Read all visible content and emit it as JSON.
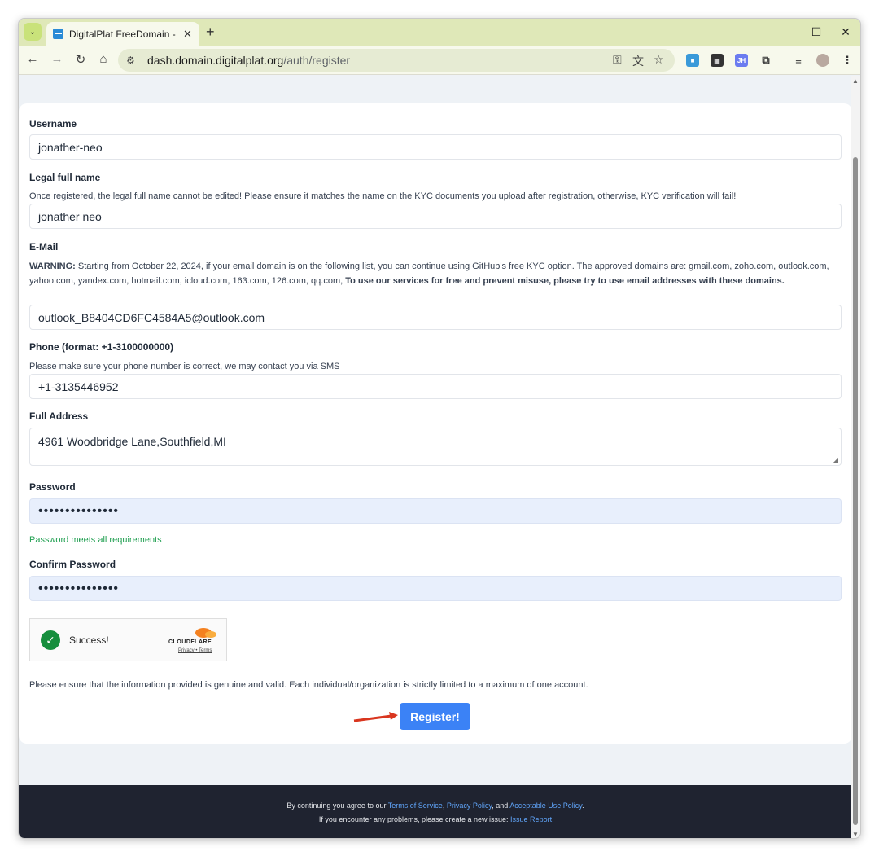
{
  "browser": {
    "tab_title": "DigitalPlat FreeDomain - Reg",
    "url_host": "dash.domain.digitalplat.org",
    "url_path": "/auth/register",
    "new_tab": "+",
    "tab_close": "✕",
    "window_controls": {
      "minimize": "–",
      "maximize": "☐",
      "close": "✕"
    },
    "nav": {
      "back": "←",
      "forward": "→",
      "reload": "↻",
      "home": "⌂"
    },
    "extensions": [
      "key-icon",
      "translate-icon",
      "star-icon",
      "apps-icon",
      "grid-icon",
      "jh-extension-icon",
      "puzzle-icon",
      "reading-list-icon",
      "profile-avatar",
      "menu-icon"
    ],
    "ext_jh_label": "JH"
  },
  "form": {
    "username": {
      "label": "Username",
      "value": "jonather-neo"
    },
    "legal_name": {
      "label": "Legal full name",
      "help": "Once registered, the legal full name cannot be edited! Please ensure it matches the name on the KYC documents you upload after registration, otherwise, KYC verification will fail!",
      "value": "jonather neo"
    },
    "email": {
      "label": "E-Mail",
      "warning_prefix": "WARNING:",
      "warning_body": " Starting from October 22, 2024, if your email domain is on the following list, you can continue using GitHub's free KYC option. The approved domains are: gmail.com, zoho.com, outlook.com, yahoo.com, yandex.com, hotmail.com, icloud.com, 163.com, 126.com, qq.com, ",
      "warning_bold": "To use our services for free and prevent misuse, please try to use email addresses with these domains.",
      "value": "outlook_B8404CD6FC4584A5@outlook.com"
    },
    "phone": {
      "label": "Phone (format: +1-3100000000)",
      "help": "Please make sure your phone number is correct, we may contact you via SMS",
      "value": "+1-3135446952"
    },
    "address": {
      "label": "Full Address",
      "value": "4961 Woodbridge Lane,Southfield,MI"
    },
    "password": {
      "label": "Password",
      "value": "•••••••••••••••",
      "status": "Password meets all requirements"
    },
    "confirm_password": {
      "label": "Confirm Password",
      "value": "•••••••••••••••"
    },
    "captcha": {
      "status": "Success!",
      "brand": "CLOUDFLARE",
      "links": "Privacy • Terms"
    },
    "notice": "Please ensure that the information provided is genuine and valid. Each individual/organization is strictly limited to a maximum of one account.",
    "submit_label": "Register!"
  },
  "footer": {
    "line1_prefix": "By continuing you agree to our ",
    "terms": "Terms of Service",
    "sep1": ", ",
    "privacy": "Privacy Policy",
    "sep2": ", and ",
    "aup": "Acceptable Use Policy",
    "line1_suffix": ".",
    "line2_prefix": "If you encounter any problems, please create a new issue: ",
    "issue_link": "Issue Report"
  },
  "colors": {
    "primary": "#3b82f6",
    "success": "#22a052",
    "footer_bg": "#1f2330",
    "arrow": "#d9361f"
  }
}
